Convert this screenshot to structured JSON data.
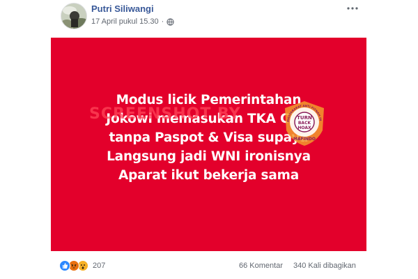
{
  "post": {
    "author": "Putri Siliwangi",
    "timestamp": "17 April pukul 15.30",
    "separator": "·",
    "privacy_icon": "globe-icon",
    "more_icon": "more-options-icon"
  },
  "banner": {
    "background_color": "#e3002b",
    "text_color": "#ffffff",
    "lines": [
      "Modus licik Pemerintahan",
      "Jokowi memasukan TKA Cina",
      "tanpa Paspot & Visa supaya",
      "Langsung jadi WNI ironisnya",
      "Aparat ikut bekerja sama"
    ],
    "watermark": "SCREENSHOT BY",
    "stamp": {
      "top": "TURN",
      "mid": "BACK",
      "bottom": "HOAX",
      "org": "MAFINDO",
      "ring": "MASYARAKAT ANTI FITNAH INDONESIA"
    }
  },
  "footer": {
    "reaction_icons": [
      "like-reaction-icon",
      "angry-reaction-icon",
      "wow-reaction-icon"
    ],
    "reaction_count": "207",
    "comments": "66 Komentar",
    "shares": "340 Kali dibagikan"
  }
}
